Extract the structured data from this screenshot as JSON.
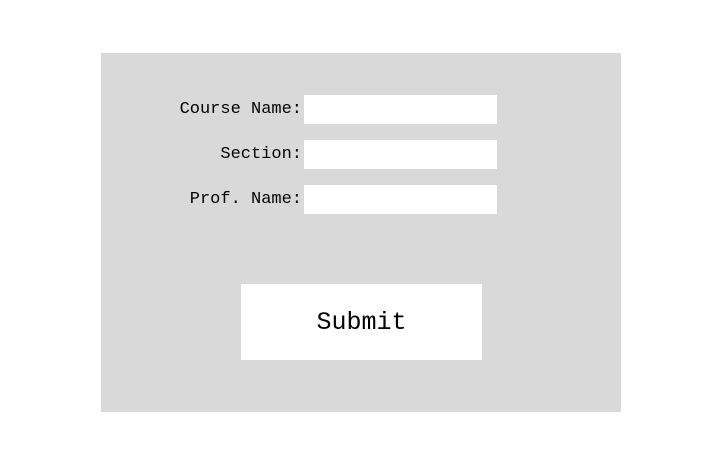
{
  "form": {
    "fields": [
      {
        "label": "Course Name:",
        "value": "",
        "placeholder": ""
      },
      {
        "label": "Section:",
        "value": "",
        "placeholder": ""
      },
      {
        "label": "Prof. Name:",
        "value": "",
        "placeholder": ""
      }
    ],
    "submit_label": "Submit"
  },
  "colors": {
    "page_background": "#ffffff",
    "panel_background": "#d9d9d9",
    "field_background": "#ffffff",
    "button_background": "#ffffff",
    "text": "#000000"
  }
}
